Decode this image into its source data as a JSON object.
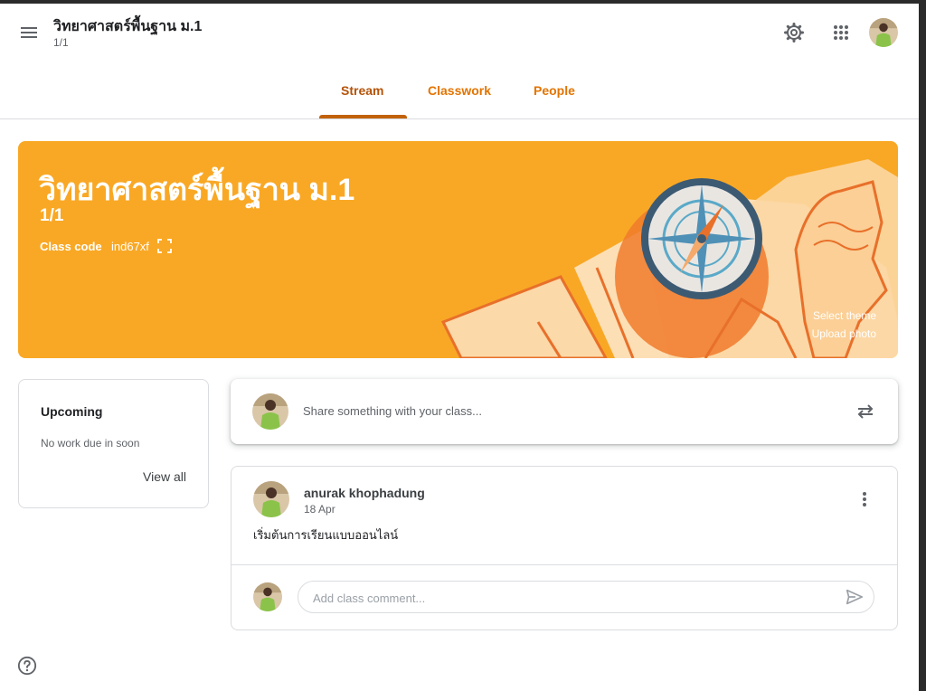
{
  "header": {
    "class_title": "วิทยาศาสตร์พื้นฐาน ม.1",
    "class_section": "1/1",
    "icons": [
      "menu-icon",
      "gear-icon",
      "apps-grid-icon"
    ]
  },
  "tabs": [
    {
      "label": "Stream",
      "active": true
    },
    {
      "label": "Classwork",
      "active": false
    },
    {
      "label": "People",
      "active": false
    }
  ],
  "banner": {
    "title": "วิทยาศาสตร์พื้นฐาน ม.1",
    "section": "1/1",
    "class_code_label": "Class code",
    "class_code": "ind67xf",
    "select_theme": "Select theme",
    "upload_photo": "Upload photo",
    "color": "#f9a825"
  },
  "upcoming": {
    "title": "Upcoming",
    "empty_text": "No work due in soon",
    "view_all": "View all"
  },
  "share": {
    "placeholder": "Share something with your class..."
  },
  "post": {
    "author": "anurak khophadung",
    "date": "18 Apr",
    "body": "เริ่มต้นการเรียนแบบออนไลน์",
    "comment_placeholder": "Add class comment..."
  },
  "colors": {
    "accent": "#e37400",
    "active_tab": "#b45309"
  }
}
